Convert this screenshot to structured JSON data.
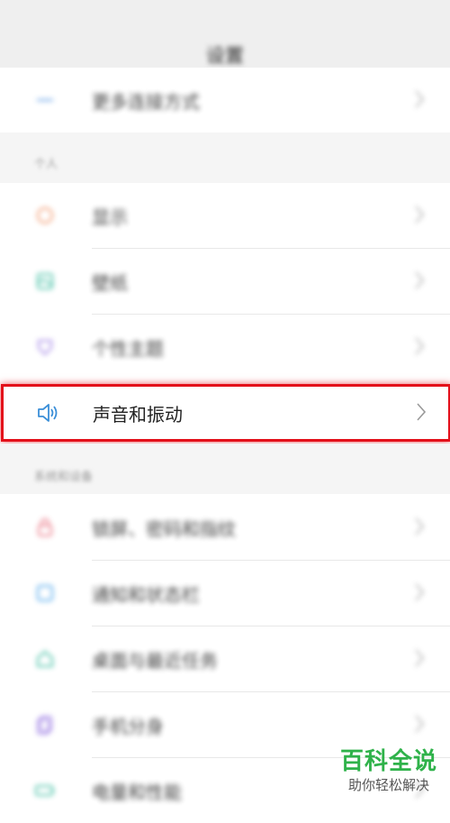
{
  "header": {
    "title": "设置"
  },
  "rows_top": [
    {
      "label": "更多连接方式"
    }
  ],
  "section_personal": {
    "title": "个人"
  },
  "personal_items": [
    {
      "label": "显示"
    },
    {
      "label": "壁纸"
    },
    {
      "label": "个性主题"
    }
  ],
  "highlighted": {
    "label": "声音和振动",
    "icon": "speaker-icon"
  },
  "section_system": {
    "title": "系统和设备"
  },
  "system_items": [
    {
      "label": "锁屏、密码和指纹"
    },
    {
      "label": "通知和状态栏"
    },
    {
      "label": "桌面与最近任务"
    },
    {
      "label": "手机分身"
    },
    {
      "label": "电量和性能"
    }
  ],
  "watermark": {
    "title": "百科全说",
    "subtitle": "助你轻松解决"
  },
  "colors": {
    "highlight": "#e3101a",
    "watermark": "#2fb24a"
  }
}
